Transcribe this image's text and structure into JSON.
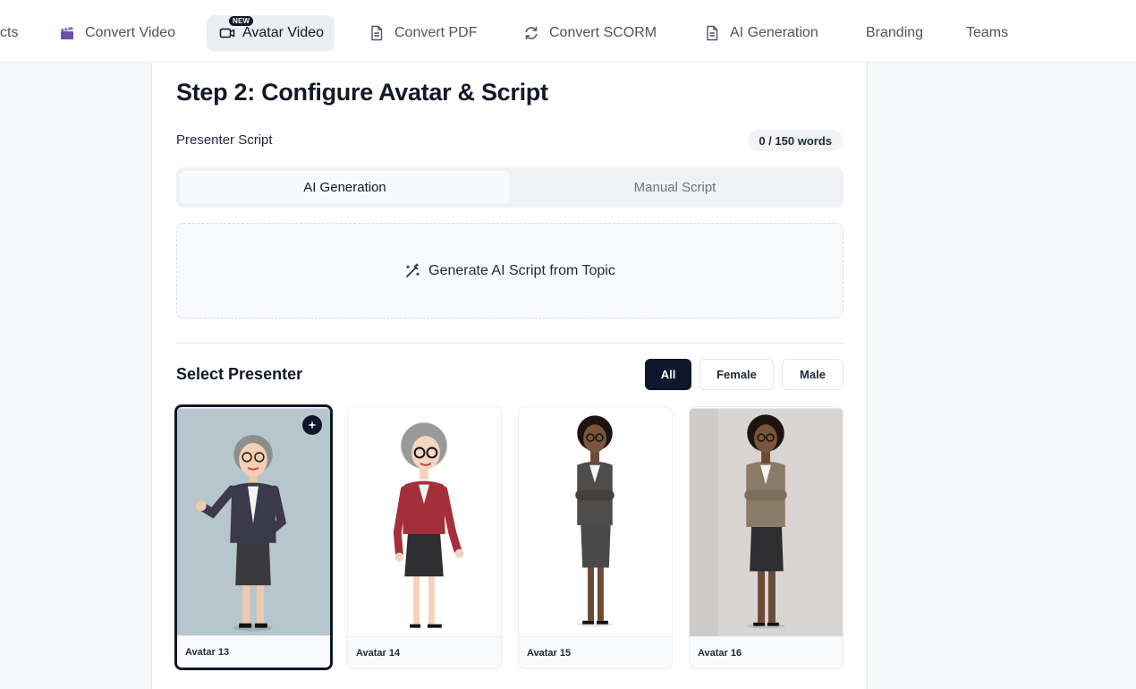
{
  "nav": {
    "items": [
      {
        "label": "cts",
        "icon": ""
      },
      {
        "label": "Convert Video",
        "icon": "clapperboard-icon"
      },
      {
        "label": "Avatar Video",
        "icon": "video-camera-icon",
        "badge": "NEW"
      },
      {
        "label": "Convert PDF",
        "icon": "document-icon"
      },
      {
        "label": "Convert SCORM",
        "icon": "refresh-icon"
      },
      {
        "label": "AI Generation",
        "icon": "document-icon"
      },
      {
        "label": "Branding",
        "icon": ""
      },
      {
        "label": "Teams",
        "icon": ""
      }
    ],
    "active_index": 2
  },
  "step": {
    "title": "Step 2: Configure Avatar & Script",
    "script_label": "Presenter Script",
    "word_count": "0 / 150 words",
    "tabs": [
      "AI Generation",
      "Manual Script"
    ],
    "active_tab": 0,
    "generate_button": "Generate AI Script from Topic"
  },
  "presenter": {
    "title": "Select Presenter",
    "filters": [
      "All",
      "Female",
      "Male"
    ],
    "active_filter": 0,
    "avatars": [
      {
        "name": "Avatar 13",
        "selected": true
      },
      {
        "name": "Avatar 14",
        "selected": false
      },
      {
        "name": "Avatar 15",
        "selected": false
      },
      {
        "name": "Avatar 16",
        "selected": false
      }
    ]
  },
  "colors": {
    "accent_dark": "#0f172a",
    "avatar13_bg": "#b7c6cc",
    "avatar16_bg": "#d9d5d2"
  }
}
